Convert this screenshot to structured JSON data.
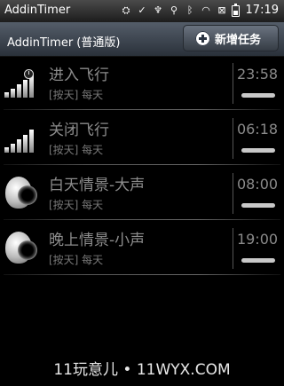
{
  "statusbar": {
    "app_name": "AddinTimer",
    "time": "17:19",
    "icons": [
      "usb-icon",
      "check-icon",
      "mic-icon",
      "usb-connection-icon",
      "bluetooth-icon",
      "wifi-icon",
      "signal-off-icon",
      "battery-icon"
    ]
  },
  "appbar": {
    "title": "AddinTimer (普通版)",
    "new_task_label": "新增任务"
  },
  "tasks": [
    {
      "name": "进入飞行",
      "repeat": "[按天] 每天",
      "time": "23:58",
      "icon": "signal-icon",
      "active": false
    },
    {
      "name": "关闭飞行",
      "repeat": "[按天] 每天",
      "time": "06:18",
      "icon": "signal-icon",
      "active": false
    },
    {
      "name": "白天情景-大声",
      "repeat": "[按天] 每天",
      "time": "08:00",
      "icon": "speaker-icon",
      "active": false
    },
    {
      "name": "晚上情景-小声",
      "repeat": "[按天] 每天",
      "time": "19:00",
      "icon": "speaker-icon",
      "active": false
    }
  ],
  "watermark": "11玩意儿 • 11WYX.COM"
}
